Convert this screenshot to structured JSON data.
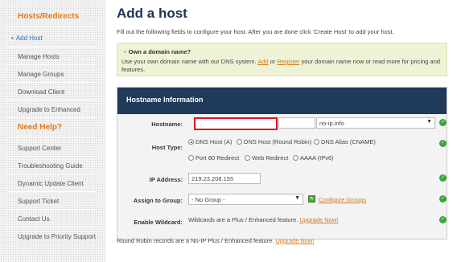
{
  "sidebar": {
    "section1_title": "Hosts/Redirects",
    "items": [
      "Add Host",
      "Manage Hosts",
      "Manage Groups",
      "Download Client",
      "Upgrade to Enhanced"
    ],
    "section2_title": "Need Help?",
    "help_items": [
      "Support Center",
      "Troubleshooting Guide",
      "Dynamic Update Client",
      "Support Ticket",
      "Contact Us",
      "Upgrade to Priority Support"
    ]
  },
  "main": {
    "title": "Add a host",
    "intro": "Fill out the following fields to configure your host. After you are done click 'Create Host' to add your host.",
    "info": {
      "title": "Own a domain name?",
      "text_before": "Use your own domain name with our DNS system. ",
      "add_link": "Add",
      "or": " or ",
      "register_link": "Register",
      "text_after": " your domain name now or read more for pricing and features."
    },
    "panel_title": "Hostname Information",
    "hostname": {
      "label": "Hostname:",
      "value": "",
      "domain": "no-ip.info"
    },
    "host_type": {
      "label": "Host Type:",
      "options": [
        "DNS Host (A)",
        "DNS Host (Round Robin)",
        "DNS Alias (CNAME)",
        "Port 80 Redirect",
        "Web Redirect",
        "AAAA (IPv6)"
      ],
      "selected": "DNS Host (A)"
    },
    "ip": {
      "label": "IP Address:",
      "value": "219.23.208.155"
    },
    "group": {
      "label": "Assign to Group:",
      "value": "- No Group -",
      "configure_link": "Configure Groups"
    },
    "wildcard": {
      "label": "Enable Wildcard:",
      "text": "Wildcards are a Plus / Enhanced feature. ",
      "link": "Upgrade Now!"
    },
    "footer": {
      "text": "Round Robin records are a No-IP Plus / Enhanced feature. ",
      "link": "Upgrade Now!"
    }
  },
  "colors": {
    "accent": "#e07a1f",
    "panel_header": "#1f3a5a",
    "highlight": "#d8141c",
    "link": "#2a6ebb"
  }
}
